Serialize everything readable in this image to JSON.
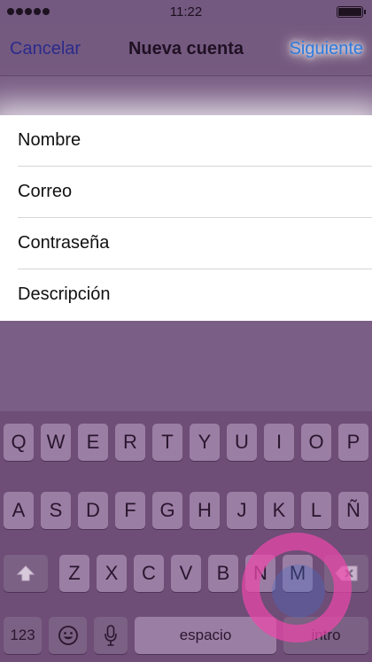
{
  "status_bar": {
    "time": "11:22",
    "signal_icon": "signal-dots-icon",
    "battery_icon": "battery-icon",
    "battery_level": 1.0
  },
  "navbar": {
    "left_label": "Cancelar",
    "title": "Nueva cuenta",
    "right_label": "Siguiente",
    "right_color": "#2e7bdc",
    "left_color": "#2b2b8a"
  },
  "form": {
    "fields": [
      {
        "placeholder": "Nombre"
      },
      {
        "placeholder": "Correo"
      },
      {
        "placeholder": "Contraseña"
      },
      {
        "placeholder": "Descripción"
      }
    ]
  },
  "keyboard": {
    "row1": [
      "Q",
      "W",
      "E",
      "R",
      "T",
      "Y",
      "U",
      "I",
      "O",
      "P"
    ],
    "row2": [
      "A",
      "S",
      "D",
      "F",
      "G",
      "H",
      "J",
      "K",
      "L",
      "Ñ"
    ],
    "row3": [
      "Z",
      "X",
      "C",
      "V",
      "B",
      "N",
      "M"
    ],
    "shift_icon": "shift-arrow-icon",
    "delete_icon": "delete-backspace-icon",
    "numbers_label": "123",
    "emoji_icon": "emoji-icon",
    "mic_icon": "microphone-icon",
    "space_label": "espacio",
    "return_label": "intro"
  },
  "watermark_icon": "pink-circle-watermark-icon"
}
